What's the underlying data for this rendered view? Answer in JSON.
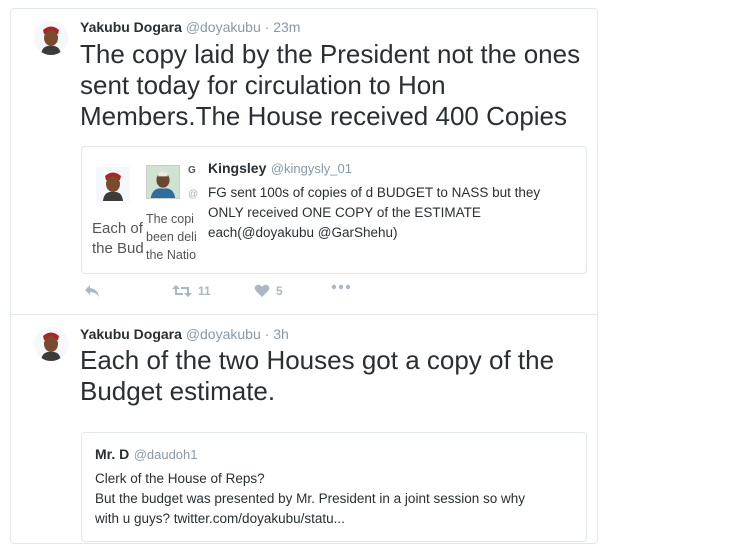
{
  "tweets": [
    {
      "name": "Yakubu Dogara",
      "handle": "@doyakubu",
      "separator": "·",
      "time": "23m",
      "text_lines": [
        "The copy laid by the President not the ones",
        "sent today for circulation to Hon",
        "Members.The House received 400 Copies"
      ],
      "quote": {
        "name": "Kingsley",
        "handle": "@kingysly_01",
        "text_lines": [
          "FG sent 100s of copies of d BUDGET to NASS but they",
          "ONLY received ONE COPY of the ESTIMATE",
          "each(@doyakubu @GarShehu)"
        ],
        "nested": {
          "g_letter": "G",
          "at": "@",
          "left_lines": [
            "Each of",
            "the Bud"
          ],
          "right_lines": [
            "The copi",
            "been deli",
            "the Natio"
          ]
        }
      },
      "actions": {
        "retweet_count": "11",
        "like_count": "5"
      }
    },
    {
      "name": "Yakubu Dogara",
      "handle": "@doyakubu",
      "separator": "·",
      "time": "3h",
      "text_lines": [
        "Each of the two Houses got a copy of the",
        "Budget estimate."
      ],
      "quote": {
        "name": "Mr. D",
        "handle": "@daudoh1",
        "text_lines": [
          "Clerk of the House of Reps?",
          "But the budget was presented by Mr. President in a joint session so why",
          "with u guys? twitter.com/doyakubu/statu..."
        ]
      }
    }
  ],
  "colors": {
    "text": "#292f33",
    "muted": "#8899a6",
    "border": "#e1e8ed",
    "action_icon": "#aab8c2"
  },
  "icons": [
    "avatar-portrait",
    "reply-icon",
    "retweet-icon",
    "heart-icon",
    "more-icon"
  ]
}
